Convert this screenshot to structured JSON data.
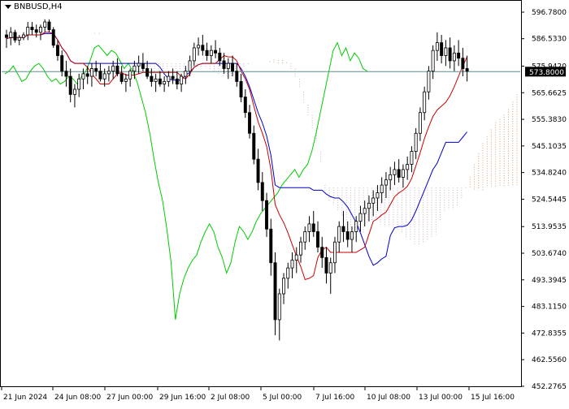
{
  "symbol": {
    "label": "BNBUSD,H4"
  },
  "current_price": {
    "label": "573.8000",
    "bg": "#000000",
    "fg": "#ffffff"
  },
  "colors": {
    "candle": "#000000",
    "tenkan": "#cc0000",
    "kijun": "#0000cc",
    "chikou": "#00cc00",
    "cloud_a": "#e0a070",
    "cloud_b": "#c8b0c8",
    "price_line": "#5f8f8f"
  },
  "chart_data": {
    "type": "candlestick",
    "indicator": "ichimoku",
    "y_ticks": [
      "596.7800",
      "586.5330",
      "575.9420",
      "565.6625",
      "555.3830",
      "545.1035",
      "534.8240",
      "524.5445",
      "513.9535",
      "503.6740",
      "493.3945",
      "483.1150",
      "472.8355",
      "462.5560",
      "452.2765"
    ],
    "y_range": [
      452.2765,
      596.78
    ],
    "x_ticks": [
      "21 Jun 2024",
      "24 Jun 08:00",
      "27 Jun 00:00",
      "29 Jun 16:00",
      "2 Jul 08:00",
      "5 Jul 00:00",
      "7 Jul 16:00",
      "10 Jul 08:00",
      "13 Jul 00:00",
      "15 Jul 16:00"
    ],
    "last_price": 573.8,
    "candles": [
      [
        588,
        590,
        583,
        587
      ],
      [
        587,
        591,
        584,
        589
      ],
      [
        589,
        590,
        585,
        586
      ],
      [
        586,
        588,
        584,
        587
      ],
      [
        587,
        589,
        586,
        588
      ],
      [
        588,
        593,
        586,
        591
      ],
      [
        591,
        593,
        588,
        590
      ],
      [
        590,
        592,
        587,
        589
      ],
      [
        589,
        592,
        586,
        591
      ],
      [
        591,
        594,
        589,
        593
      ],
      [
        593,
        594,
        589,
        590
      ],
      [
        590,
        591,
        583,
        584
      ],
      [
        584,
        586,
        578,
        580
      ],
      [
        580,
        582,
        572,
        574
      ],
      [
        574,
        578,
        568,
        572
      ],
      [
        572,
        575,
        562,
        565
      ],
      [
        565,
        569,
        560,
        567
      ],
      [
        567,
        573,
        564,
        571
      ],
      [
        571,
        575,
        567,
        573
      ],
      [
        573,
        576,
        569,
        572
      ],
      [
        572,
        577,
        568,
        575
      ],
      [
        575,
        578,
        572,
        574
      ],
      [
        574,
        577,
        570,
        571
      ],
      [
        571,
        575,
        568,
        573
      ],
      [
        573,
        576,
        570,
        574
      ],
      [
        574,
        578,
        571,
        576
      ],
      [
        576,
        579,
        572,
        573
      ],
      [
        573,
        576,
        569,
        570
      ],
      [
        570,
        573,
        566,
        571
      ],
      [
        571,
        575,
        568,
        574
      ],
      [
        574,
        578,
        571,
        576
      ],
      [
        576,
        580,
        573,
        577
      ],
      [
        577,
        581,
        574,
        575
      ],
      [
        575,
        578,
        571,
        572
      ],
      [
        572,
        575,
        568,
        570
      ],
      [
        570,
        573,
        566,
        571
      ],
      [
        571,
        574,
        568,
        569
      ],
      [
        569,
        572,
        566,
        570
      ],
      [
        570,
        574,
        568,
        572
      ],
      [
        572,
        575,
        569,
        571
      ],
      [
        571,
        574,
        567,
        569
      ],
      [
        569,
        573,
        566,
        572
      ],
      [
        572,
        576,
        569,
        574
      ],
      [
        574,
        580,
        572,
        578
      ],
      [
        578,
        585,
        576,
        583
      ],
      [
        583,
        587,
        580,
        584
      ],
      [
        584,
        588,
        580,
        582
      ],
      [
        582,
        585,
        578,
        580
      ],
      [
        580,
        584,
        577,
        582
      ],
      [
        582,
        586,
        579,
        581
      ],
      [
        581,
        583,
        576,
        578
      ],
      [
        578,
        581,
        573,
        575
      ],
      [
        575,
        579,
        571,
        577
      ],
      [
        577,
        580,
        572,
        574
      ],
      [
        574,
        577,
        568,
        570
      ],
      [
        570,
        573,
        562,
        564
      ],
      [
        564,
        567,
        556,
        558
      ],
      [
        558,
        561,
        548,
        550
      ],
      [
        550,
        553,
        538,
        540
      ],
      [
        540,
        544,
        528,
        531
      ],
      [
        531,
        535,
        520,
        524
      ],
      [
        524,
        527,
        510,
        513
      ],
      [
        513,
        517,
        495,
        500
      ],
      [
        500,
        504,
        472,
        478
      ],
      [
        478,
        490,
        470,
        488
      ],
      [
        488,
        496,
        484,
        494
      ],
      [
        494,
        500,
        490,
        498
      ],
      [
        498,
        504,
        494,
        501
      ],
      [
        501,
        506,
        496,
        503
      ],
      [
        503,
        510,
        500,
        508
      ],
      [
        508,
        514,
        505,
        512
      ],
      [
        512,
        518,
        508,
        515
      ],
      [
        515,
        520,
        510,
        512
      ],
      [
        512,
        516,
        504,
        506
      ],
      [
        506,
        510,
        498,
        502
      ],
      [
        502,
        506,
        492,
        496
      ],
      [
        496,
        502,
        488,
        500
      ],
      [
        500,
        510,
        496,
        508
      ],
      [
        508,
        516,
        504,
        514
      ],
      [
        514,
        520,
        508,
        512
      ],
      [
        512,
        516,
        506,
        509
      ],
      [
        509,
        514,
        504,
        512
      ],
      [
        512,
        518,
        508,
        516
      ],
      [
        516,
        522,
        512,
        519
      ],
      [
        519,
        524,
        514,
        521
      ],
      [
        521,
        526,
        516,
        523
      ],
      [
        523,
        528,
        518,
        525
      ],
      [
        525,
        530,
        520,
        527
      ],
      [
        527,
        533,
        523,
        530
      ],
      [
        530,
        535,
        525,
        532
      ],
      [
        532,
        537,
        528,
        534
      ],
      [
        534,
        539,
        530,
        536
      ],
      [
        536,
        540,
        531,
        533
      ],
      [
        533,
        538,
        529,
        536
      ],
      [
        536,
        541,
        532,
        538
      ],
      [
        538,
        545,
        535,
        543
      ],
      [
        543,
        552,
        540,
        550
      ],
      [
        550,
        560,
        547,
        558
      ],
      [
        558,
        568,
        555,
        566
      ],
      [
        566,
        576,
        563,
        574
      ],
      [
        574,
        584,
        571,
        582
      ],
      [
        582,
        589,
        578,
        585
      ],
      [
        585,
        588,
        577,
        580
      ],
      [
        580,
        586,
        576,
        583
      ],
      [
        583,
        587,
        575,
        578
      ],
      [
        578,
        584,
        574,
        581
      ],
      [
        581,
        586,
        576,
        579
      ],
      [
        579,
        583,
        572,
        575
      ],
      [
        575,
        580,
        570,
        574
      ]
    ]
  }
}
